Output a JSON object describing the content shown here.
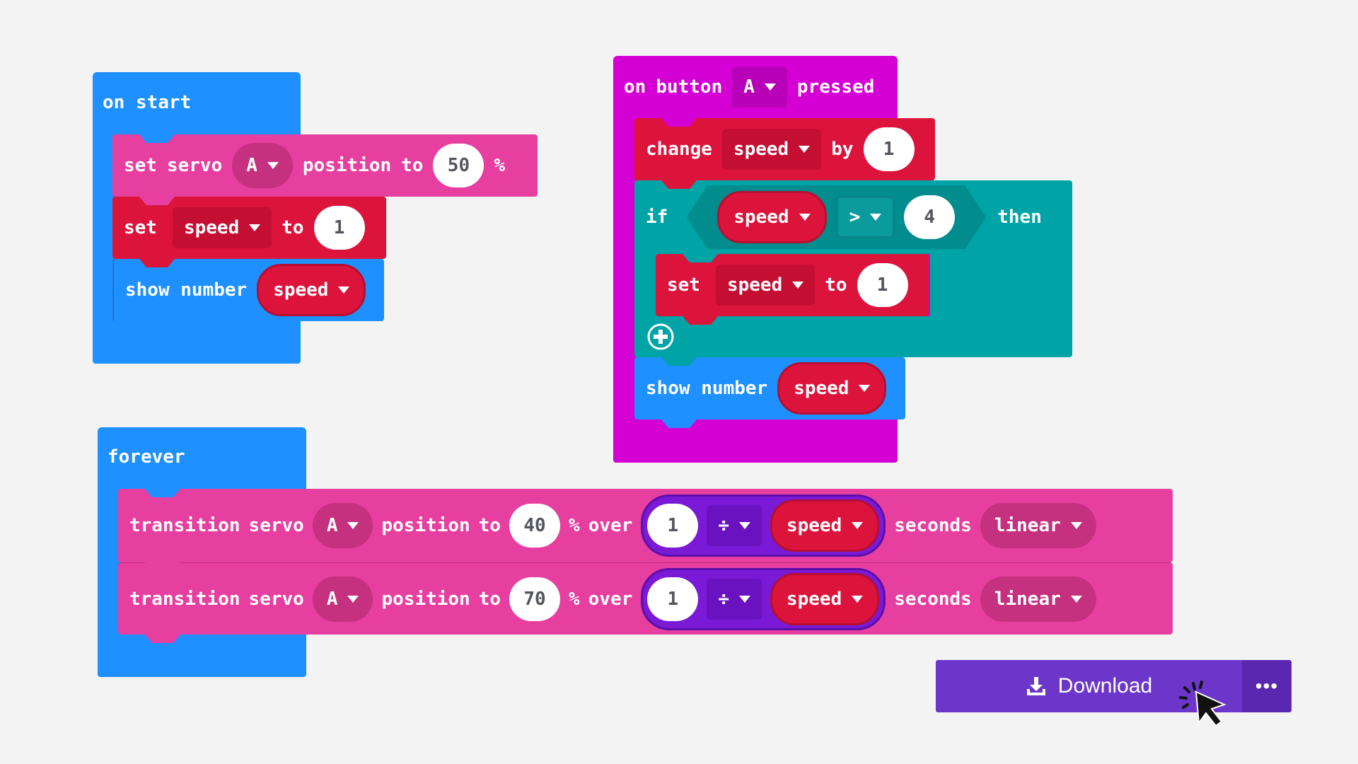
{
  "colors": {
    "loops": "#1e90ff",
    "input": "#d400d4",
    "servo": "#e63fa0",
    "variables": "#dc143c",
    "logic": "#00a4a6",
    "math": "#7a19d6",
    "download": "#6b36c9"
  },
  "on_start": {
    "title": "on start",
    "set_servo": {
      "set": "set",
      "servo": "servo",
      "pin": "A",
      "position": "position",
      "to": "to",
      "value": "50",
      "unit": "%"
    },
    "set_speed": {
      "set": "set",
      "variable": "speed",
      "to": "to",
      "value": "1"
    },
    "show_number": {
      "label": "show number",
      "variable": "speed"
    }
  },
  "on_button": {
    "on": "on",
    "button": "button",
    "pin": "A",
    "pressed": "pressed",
    "change": {
      "change": "change",
      "variable": "speed",
      "by": "by",
      "value": "1"
    },
    "if_block": {
      "if": "if",
      "variable": "speed",
      "operator": ">",
      "value": "4",
      "then": "then",
      "set": {
        "set": "set",
        "variable": "speed",
        "to": "to",
        "value": "1"
      },
      "add_icon": "plus-circle-icon"
    },
    "show_number": {
      "label": "show number",
      "variable": "speed"
    }
  },
  "forever": {
    "title": "forever",
    "transitions": [
      {
        "transition": "transition",
        "servo": "servo",
        "pin": "A",
        "position": "position",
        "to": "to",
        "value": "40",
        "unit": "%",
        "over": "over",
        "dividend": "1",
        "operator": "÷",
        "divisor": "speed",
        "seconds": "seconds",
        "easing": "linear"
      },
      {
        "transition": "transition",
        "servo": "servo",
        "pin": "A",
        "position": "position",
        "to": "to",
        "value": "70",
        "unit": "%",
        "over": "over",
        "dividend": "1",
        "operator": "÷",
        "divisor": "speed",
        "seconds": "seconds",
        "easing": "linear"
      }
    ]
  },
  "toolbar": {
    "download_label": "Download",
    "download_icon": "download-icon",
    "more_label": "•••",
    "cursor_icon": "pointer-cursor-icon"
  }
}
